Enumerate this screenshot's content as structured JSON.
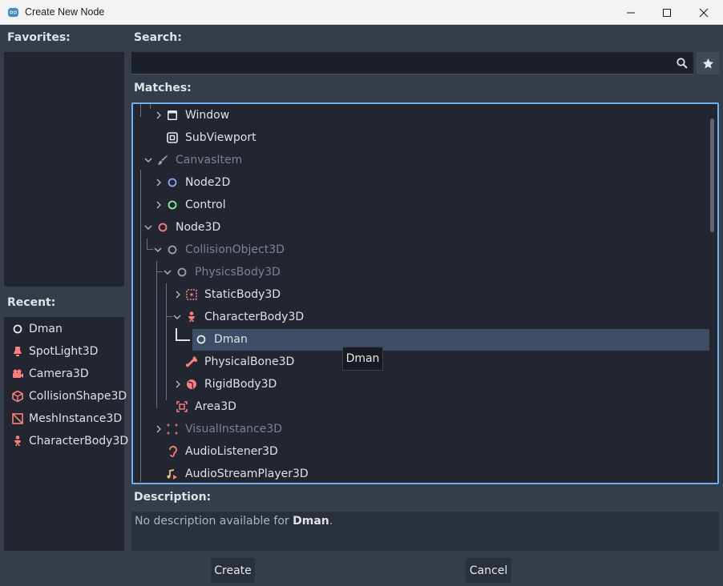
{
  "window": {
    "title": "Create New Node",
    "controls": [
      "minimize-icon",
      "maximize-icon",
      "close-icon"
    ]
  },
  "favorites": {
    "label": "Favorites:"
  },
  "recent": {
    "label": "Recent:",
    "items": [
      {
        "label": "Dman",
        "icon": "node-circle-icon"
      },
      {
        "label": "SpotLight3D",
        "icon": "spotlight-icon"
      },
      {
        "label": "Camera3D",
        "icon": "camera-icon"
      },
      {
        "label": "CollisionShape3D",
        "icon": "collision-shape-icon"
      },
      {
        "label": "MeshInstance3D",
        "icon": "mesh-instance-icon"
      },
      {
        "label": "CharacterBody3D",
        "icon": "character-body-icon"
      }
    ]
  },
  "search": {
    "label": "Search:",
    "value": "",
    "placeholder": ""
  },
  "matches": {
    "label": "Matches:",
    "rows": [
      {
        "label": "Window",
        "icon": "window-icon",
        "dim": false
      },
      {
        "label": "SubViewport",
        "icon": "subviewport-icon",
        "dim": false
      },
      {
        "label": "CanvasItem",
        "icon": "brush-icon",
        "dim": true
      },
      {
        "label": "Node2D",
        "icon": "node2d-circle-icon",
        "dim": false
      },
      {
        "label": "Control",
        "icon": "control-circle-icon",
        "dim": false
      },
      {
        "label": "Node3D",
        "icon": "node3d-circle-icon",
        "dim": false
      },
      {
        "label": "CollisionObject3D",
        "icon": "collision-object-icon",
        "dim": true
      },
      {
        "label": "PhysicsBody3D",
        "icon": "physics-body-icon",
        "dim": true
      },
      {
        "label": "StaticBody3D",
        "icon": "static-body-icon",
        "dim": false
      },
      {
        "label": "CharacterBody3D",
        "icon": "character-body-icon",
        "dim": false
      },
      {
        "label": "Dman",
        "icon": "node-circle-icon",
        "dim": false,
        "selected": true
      },
      {
        "label": "PhysicalBone3D",
        "icon": "physical-bone-icon",
        "dim": false
      },
      {
        "label": "RigidBody3D",
        "icon": "rigid-body-icon",
        "dim": false
      },
      {
        "label": "Area3D",
        "icon": "area-icon",
        "dim": false
      },
      {
        "label": "VisualInstance3D",
        "icon": "visual-instance-icon",
        "dim": true
      },
      {
        "label": "AudioListener3D",
        "icon": "audio-listener-icon",
        "dim": false
      },
      {
        "label": "AudioStreamPlayer3D",
        "icon": "audio-stream-player-icon",
        "dim": false
      }
    ]
  },
  "tooltip": {
    "text": "Dman"
  },
  "description": {
    "label": "Description:",
    "prefix": "No description available for ",
    "name": "Dman",
    "suffix": "."
  },
  "buttons": {
    "create": "Create",
    "cancel": "Cancel"
  },
  "colors": {
    "accent": "#6fb1f0",
    "node3d": "#fc7f7f",
    "node2d": "#8da5f3",
    "control": "#8eef97",
    "selected": "#3b4e66"
  }
}
